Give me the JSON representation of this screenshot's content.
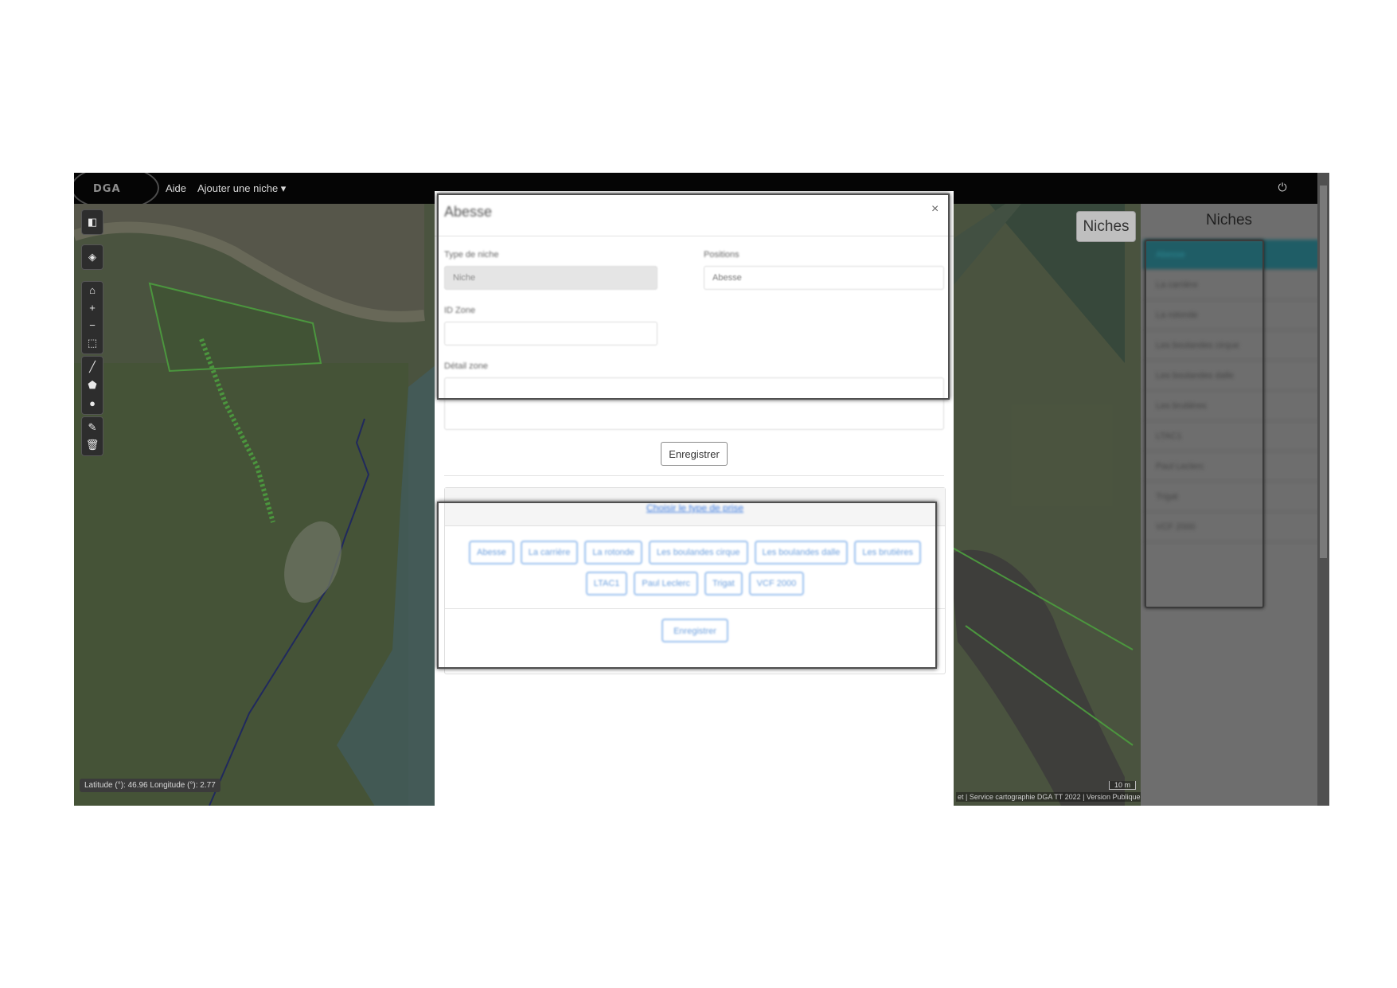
{
  "nav": {
    "logo": "DGA",
    "aide": "Aide",
    "ajouter": "Ajouter une niche ▾",
    "power_icon": "power-icon"
  },
  "map": {
    "coords": "Latitude (°): 46.96 Longitude (°): 2.77",
    "attribution": "et | Service cartographie DGA TT 2022 | Version Publique",
    "scale": "10 m",
    "tools": [
      "sidebar-toggle-icon",
      "layers-icon",
      "home-icon",
      "zoom-in-icon",
      "zoom-out-icon",
      "zoom-box-icon",
      "draw-line-icon",
      "draw-polygon-icon",
      "draw-marker-icon",
      "edit-icon",
      "delete-icon"
    ],
    "colors": {
      "vegetation": "#5d6d4f",
      "outline": "#5fd14a",
      "water": "#4f7c8a"
    }
  },
  "niches_button": "Niches",
  "panel": {
    "title": "Niches",
    "items": [
      "Abesse",
      "La carrière",
      "La rotonde",
      "Les boulandes cirque",
      "Les boulandes dalle",
      "Les brutières",
      "LTAC1",
      "Paul Leclerc",
      "Trigat",
      "VCF 2000"
    ]
  },
  "modal": {
    "title": "Abesse",
    "close": "×",
    "type_label": "Type de niche",
    "type_value": "Niche",
    "positions_label": "Positions",
    "positions_value": "Abesse",
    "idzone_label": "ID Zone",
    "idzone_value": "",
    "detail_label": "Détail zone",
    "detail_value": "",
    "save_label": "Enregistrer",
    "sub": {
      "link": "Choisir le type de prise",
      "chips": [
        "Abesse",
        "La carrière",
        "La rotonde",
        "Les boulandes cirque",
        "Les boulandes dalle",
        "Les brutières",
        "LTAC1",
        "Paul Leclerc",
        "Trigat",
        "VCF 2000"
      ],
      "save_label": "Enregistrer"
    }
  }
}
